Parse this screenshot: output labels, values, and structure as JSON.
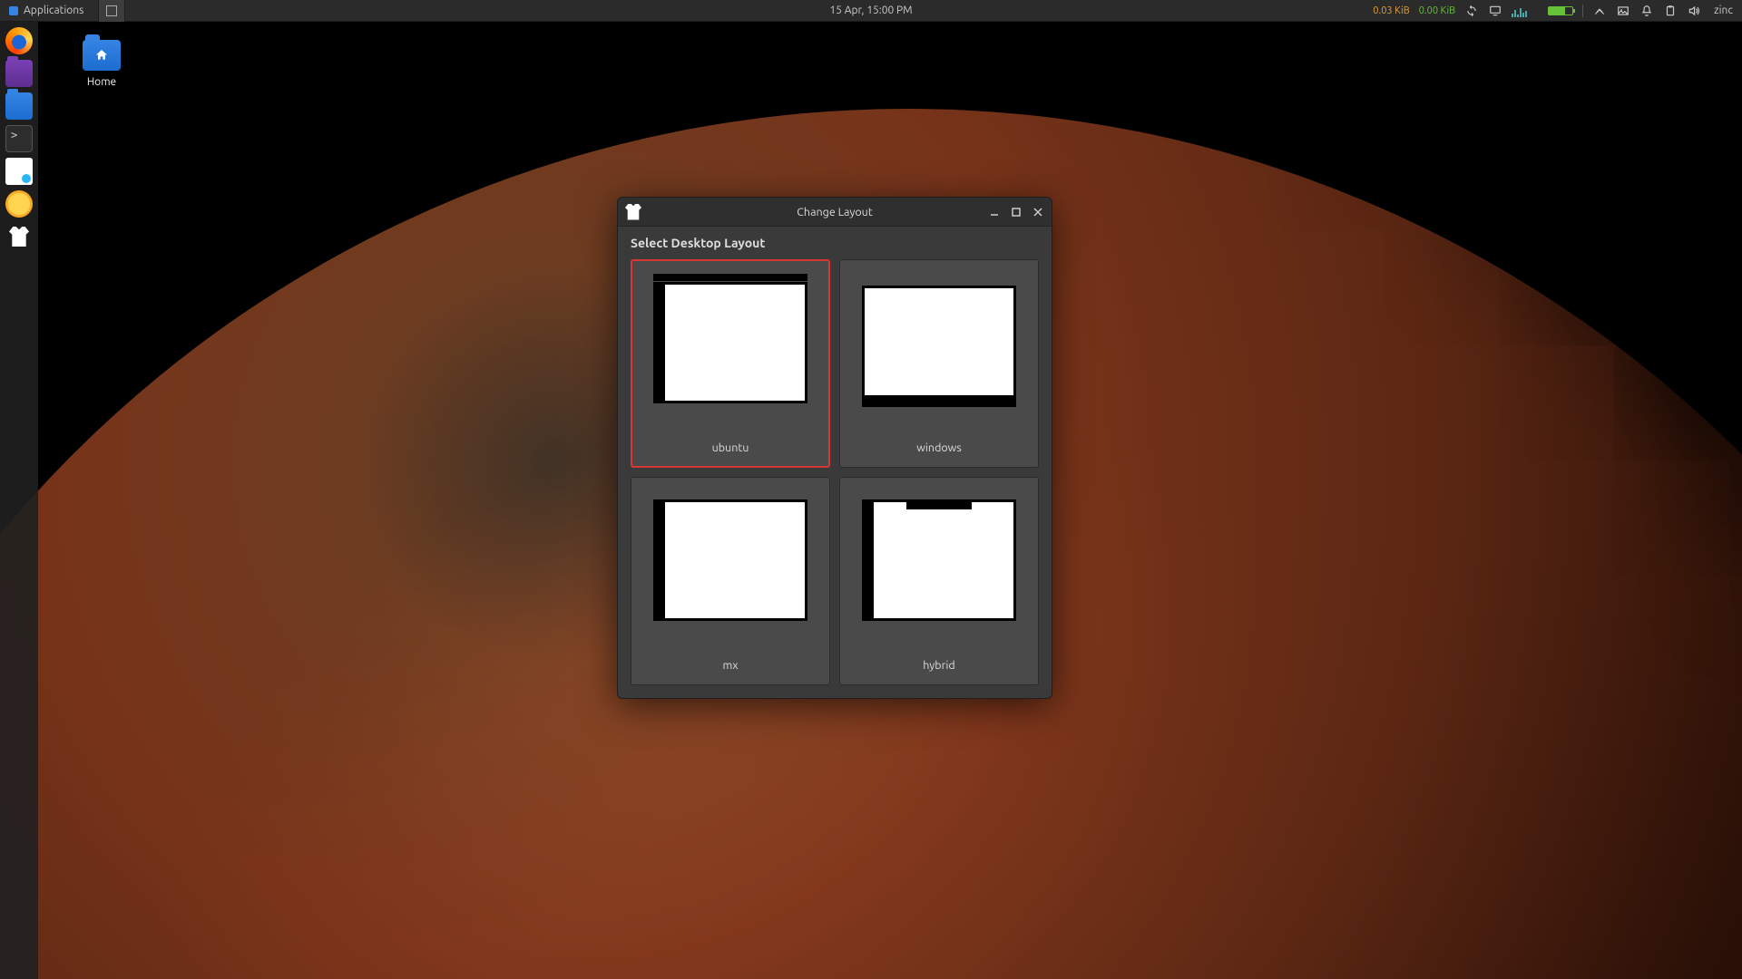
{
  "panel": {
    "applications_label": "Applications",
    "clock": "15 Apr, 15:00 PM",
    "net_down": "0.03 KiB",
    "net_up": "0.00 KiB",
    "user": "zinc"
  },
  "desktop": {
    "home_label": "Home"
  },
  "dock": {
    "items": [
      {
        "name": "firefox-icon"
      },
      {
        "name": "files-purple-icon"
      },
      {
        "name": "files-blue-icon"
      },
      {
        "name": "terminal-icon"
      },
      {
        "name": "document-icon"
      },
      {
        "name": "app-yellow-icon"
      },
      {
        "name": "layout-app-icon"
      }
    ]
  },
  "dialog": {
    "title": "Change Layout",
    "section_title": "Select Desktop Layout",
    "options": [
      {
        "id": "ubuntu",
        "label": "ubuntu",
        "selected": true
      },
      {
        "id": "windows",
        "label": "windows",
        "selected": false
      },
      {
        "id": "mx",
        "label": "mx",
        "selected": false
      },
      {
        "id": "hybrid",
        "label": "hybrid",
        "selected": false
      }
    ]
  }
}
